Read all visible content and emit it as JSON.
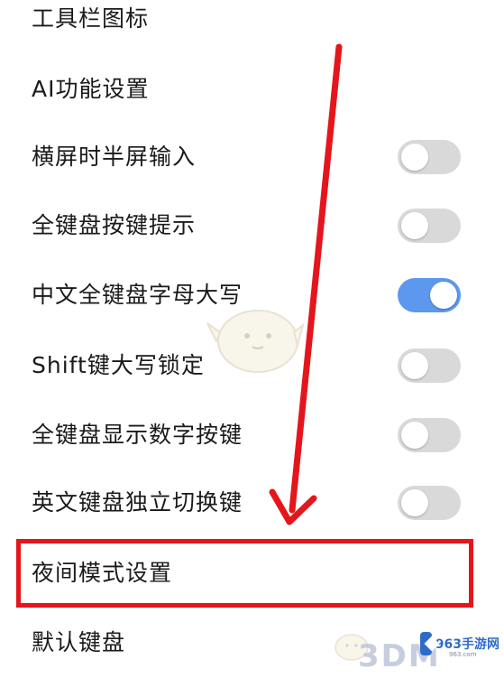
{
  "settings": {
    "items": [
      {
        "label": "工具栏图标",
        "toggle": null
      },
      {
        "label": "AI功能设置",
        "toggle": null
      },
      {
        "label": "横屏时半屏输入",
        "toggle": false
      },
      {
        "label": "全键盘按键提示",
        "toggle": false
      },
      {
        "label": "中文全键盘字母大写",
        "toggle": true
      },
      {
        "label": "Shift键大写锁定",
        "toggle": false
      },
      {
        "label": "全键盘显示数字按键",
        "toggle": false
      },
      {
        "label": "英文键盘独立切换键",
        "toggle": false
      },
      {
        "label": "夜间模式设置",
        "toggle": null,
        "highlighted": true
      },
      {
        "label": "默认键盘",
        "toggle": null
      }
    ]
  },
  "watermarks": {
    "brand_3d": "3DM",
    "site_name": "963手游网",
    "site_sub": "963.com"
  },
  "colors": {
    "toggle_on": "#5b98ee",
    "toggle_off": "#d9d9d9",
    "annotation_red": "#e4161b"
  }
}
